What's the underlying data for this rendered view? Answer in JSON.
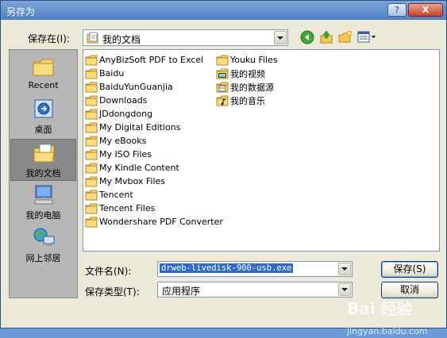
{
  "window": {
    "title": "另存为",
    "help_label": "?",
    "close_label": "X"
  },
  "location": {
    "label": "保存在(I):",
    "value": "我的文档"
  },
  "toolbar": {
    "back_icon": "back-arrow-icon",
    "up_icon": "up-folder-icon",
    "new_folder_icon": "new-folder-icon",
    "views_icon": "views-menu-icon"
  },
  "places": [
    {
      "label": "Recent",
      "icon": "recent-folder-icon"
    },
    {
      "label": "桌面",
      "icon": "desktop-icon"
    },
    {
      "label": "我的文档",
      "icon": "my-documents-icon",
      "selected": true
    },
    {
      "label": "我的电脑",
      "icon": "my-computer-icon"
    },
    {
      "label": "网上邻居",
      "icon": "network-places-icon"
    }
  ],
  "files": {
    "column1": [
      "AnyBizSoft PDF to Excel",
      "Baidu",
      "BaiduYunGuanjia",
      "Downloads",
      "JDdongdong",
      "My Digital Editions",
      "My eBooks",
      "My ISO Files",
      "My Kindle Content",
      "My Mvbox Files",
      "Tencent",
      "Tencent Files",
      "Wondershare PDF Converter"
    ],
    "column2": [
      {
        "name": "Youku Files",
        "icon": "folder"
      },
      {
        "name": "我的视频",
        "icon": "video-folder"
      },
      {
        "name": "我的数据源",
        "icon": "data-source-folder"
      },
      {
        "name": "我的音乐",
        "icon": "music-folder"
      }
    ]
  },
  "filename": {
    "label": "文件名(N):",
    "value": "drweb-livedisk-900-usb.exe"
  },
  "filetype": {
    "label": "保存类型(T):",
    "value": "应用程序"
  },
  "buttons": {
    "save": "保存(S)",
    "cancel": "取消"
  },
  "watermark": {
    "text": "Bai 经验",
    "sub": "jingyan.baidu.com"
  },
  "colors": {
    "titlebar": "#6894cf",
    "selection": "#316ac5",
    "dialog_bg": "#ece9d8"
  }
}
